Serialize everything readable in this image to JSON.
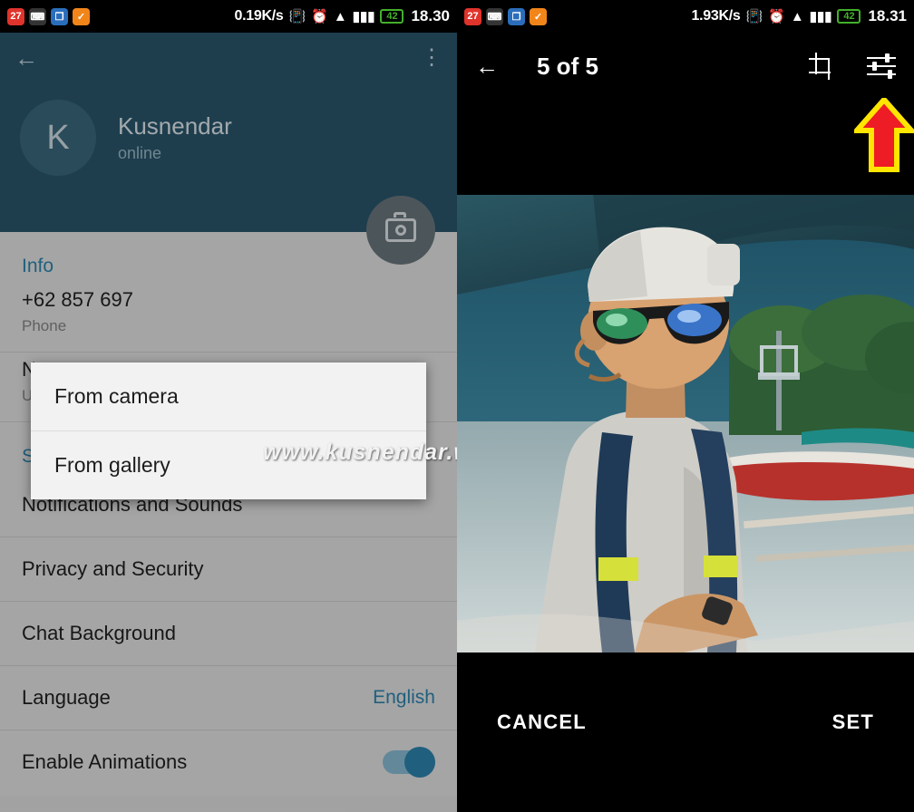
{
  "left": {
    "statusbar": {
      "icons": [
        "message-badge-icon",
        "blackberry-icon",
        "chat-icon",
        "shield-icon"
      ],
      "netspeed": "0.19K/s",
      "vibrate_icon": "vibrate-icon",
      "alarm_icon": "alarm-icon",
      "wifi_icon": "wifi-icon",
      "signal_icon": "signal-icon",
      "battery": "42",
      "clock": "18.30"
    },
    "header": {
      "back_icon": "back-arrow-icon",
      "menu_icon": "overflow-menu-icon",
      "avatar_initial": "K",
      "name": "Kusnendar",
      "status": "online",
      "camera_icon": "camera-icon"
    },
    "info": {
      "title": "Info",
      "phone_value": "+62 857 697",
      "phone_label": "Phone",
      "username_value": "N",
      "username_label": "U"
    },
    "settings": {
      "title": "Settings",
      "items": [
        {
          "label": "Notifications and Sounds",
          "value": ""
        },
        {
          "label": "Privacy and Security",
          "value": ""
        },
        {
          "label": "Chat Background",
          "value": ""
        },
        {
          "label": "Language",
          "value": "English"
        },
        {
          "label": "Enable Animations",
          "value": ""
        }
      ]
    },
    "popup": {
      "items": [
        "From camera",
        "From gallery"
      ]
    },
    "watermark": "www.kusnendar.web.id"
  },
  "right": {
    "statusbar": {
      "netspeed": "1.93K/s",
      "battery": "42",
      "clock": "18.31"
    },
    "topbar": {
      "back_icon": "back-arrow-icon",
      "title": "5 of 5",
      "crop_icon": "crop-icon",
      "tune_icon": "tune-icon"
    },
    "highlight": {
      "arrow_icon": "up-arrow-annotation",
      "fill_color": "#ee1c25",
      "outline_color": "#ffe600"
    },
    "bottom": {
      "cancel_label": "CANCEL",
      "set_label": "SET"
    },
    "photo": {
      "alt": "man-with-sunglasses-on-boat-photo"
    }
  }
}
